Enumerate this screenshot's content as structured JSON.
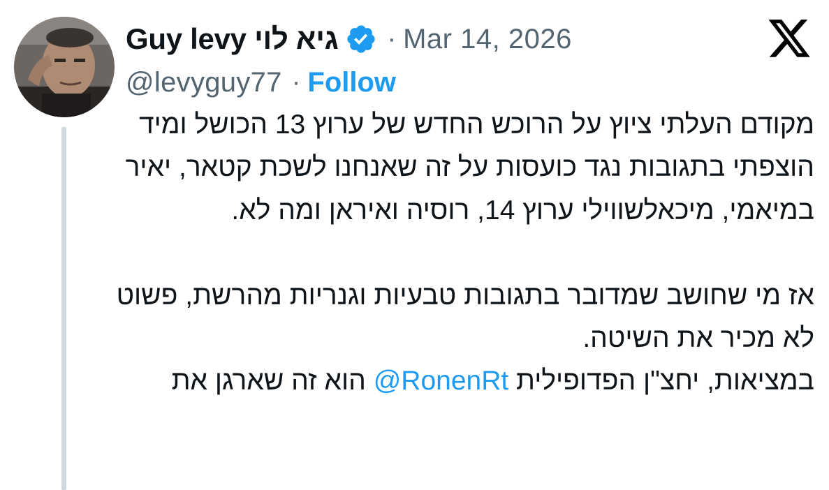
{
  "tweet": {
    "display_name": "Guy levy גיא לוי",
    "dot": "·",
    "timestamp": "Mar 14, 2026",
    "handle": "@levyguy77",
    "follow_sep": "·",
    "follow_label": "Follow",
    "verified_icon": "verified-badge-icon",
    "brand_icon": "x-logo-icon",
    "colors": {
      "accent": "#1d9bf0",
      "secondary_text": "#536471",
      "thread_line": "#cfd9de"
    },
    "body": {
      "para1": "מקודם העלתי ציוץ על הרוכש החדש של ערוץ 13 הכושל ומיד הוצפתי בתגובות נגד כועסות על זה שאנחנו לשכת קטאר, יאיר במיאמי, מיכאלשווילי ערוץ 14, רוסיה ואיראן ומה לא.",
      "para2": "אז מי שחושב שמדובר בתגובות טבעיות וגנריות מהרשת, פשוט לא מכיר את השיטה.",
      "para3_before": "במציאות, יחצ\"ן הפדופילית ",
      "para3_mention": "@RonenRt",
      "para3_after": " הוא זה שארגן את"
    }
  }
}
